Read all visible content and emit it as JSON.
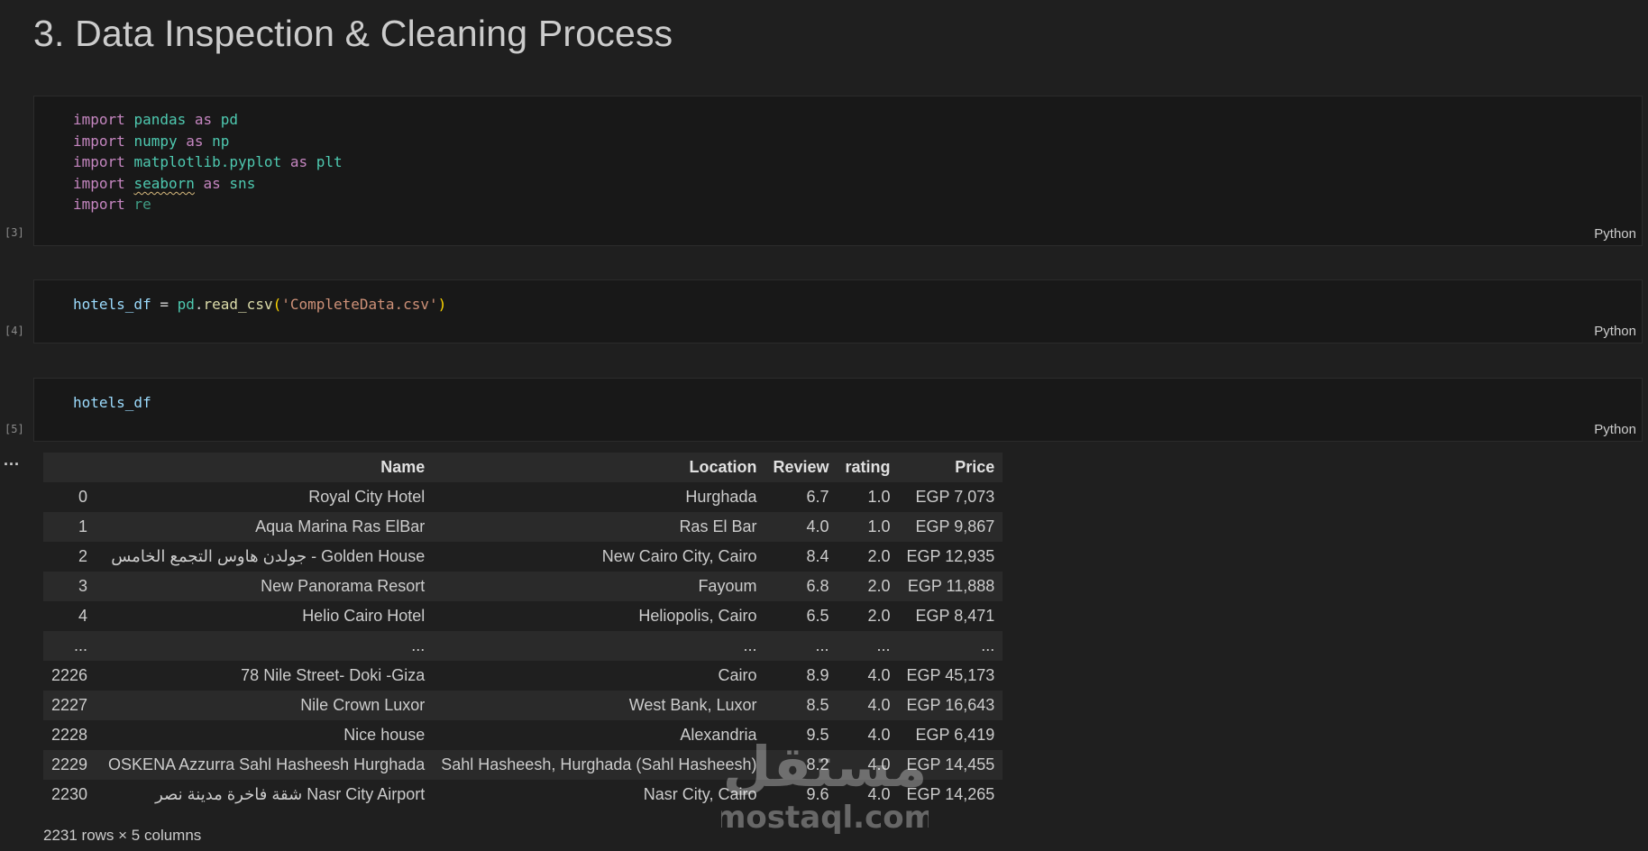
{
  "heading": "3. Data Inspection & Cleaning Process",
  "cells": [
    {
      "exec_count": "[3]",
      "language": "Python",
      "lines": [
        [
          "import",
          "pandas",
          "as",
          "pd"
        ],
        [
          "import",
          "numpy",
          "as",
          "np"
        ],
        [
          "import",
          "matplotlib.pyplot",
          "as",
          "plt"
        ],
        [
          "import",
          "seaborn",
          "as",
          "sns"
        ],
        [
          "import",
          "re"
        ]
      ]
    },
    {
      "exec_count": "[4]",
      "language": "Python",
      "code": {
        "var": "hotels_df",
        "op": " = ",
        "obj": "pd",
        "fn": "read_csv",
        "arg": "'CompleteData.csv'"
      }
    },
    {
      "exec_count": "[5]",
      "language": "Python",
      "code": {
        "var": "hotels_df"
      }
    }
  ],
  "output_ellipsis": "...",
  "dataframe": {
    "columns": [
      "",
      "Name",
      "Location",
      "Review",
      "rating",
      "Price"
    ],
    "rows": [
      [
        "0",
        "Royal City Hotel",
        "Hurghada",
        "6.7",
        "1.0",
        "EGP 7,073"
      ],
      [
        "1",
        "Aqua Marina Ras ElBar",
        "Ras El Bar",
        "4.0",
        "1.0",
        "EGP 9,867"
      ],
      [
        "2",
        "جولدن هاوس التجمع الخامس - Golden House",
        "New Cairo City, Cairo",
        "8.4",
        "2.0",
        "EGP 12,935"
      ],
      [
        "3",
        "New Panorama Resort",
        "Fayoum",
        "6.8",
        "2.0",
        "EGP 11,888"
      ],
      [
        "4",
        "Helio Cairo Hotel",
        "Heliopolis, Cairo",
        "6.5",
        "2.0",
        "EGP 8,471"
      ],
      [
        "...",
        "...",
        "...",
        "...",
        "...",
        "..."
      ],
      [
        "2226",
        "78 Nile Street- Doki -Giza",
        "Cairo",
        "8.9",
        "4.0",
        "EGP 45,173"
      ],
      [
        "2227",
        "Nile Crown Luxor",
        "West Bank, Luxor",
        "8.5",
        "4.0",
        "EGP 16,643"
      ],
      [
        "2228",
        "Nice house",
        "Alexandria",
        "9.5",
        "4.0",
        "EGP 6,419"
      ],
      [
        "2229",
        "OSKENA Azzurra Sahl Hasheesh Hurghada",
        "Sahl Hasheesh, Hurghada (Sahl Hasheesh)",
        "8.2",
        "4.0",
        "EGP 14,455"
      ],
      [
        "2230",
        "شقة فاخرة مدينة نصر Nasr City Airport",
        "Nasr City, Cairo",
        "9.6",
        "4.0",
        "EGP 14,265"
      ]
    ],
    "shape": "2231 rows × 5 columns"
  },
  "watermark": {
    "arabic": "مستقل",
    "latin": "mostaql.com"
  },
  "colors": {
    "background": "#1f1f1f",
    "cell_background": "#181818",
    "keyword": "#c586c0",
    "module": "#4ec9b0",
    "variable": "#9cdcfe",
    "function": "#dcdcaa",
    "string": "#ce9178"
  }
}
